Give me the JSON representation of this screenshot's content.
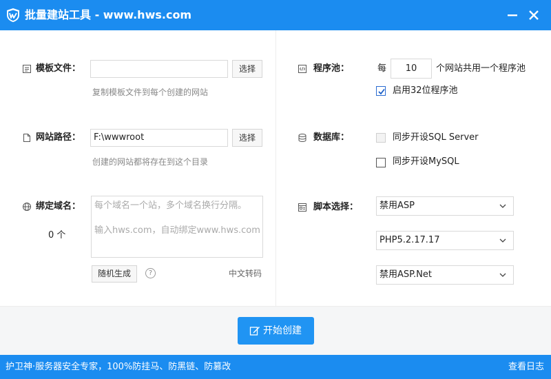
{
  "window": {
    "title": "批量建站工具 - www.hws.com"
  },
  "template": {
    "label": "模板文件：",
    "value": "",
    "button": "选择",
    "hint": "复制模板文件到每个创建的网站"
  },
  "site_path": {
    "label": "网站路径：",
    "value": "F:\\wwwroot",
    "button": "选择",
    "hint": "创建的网站都将存在到这个目录"
  },
  "domain": {
    "label": "绑定域名：",
    "count": "0 个",
    "placeholder_line1": "每个域名一个站，多个域名换行分隔。",
    "placeholder_line2": "输入hws.com，自动绑定www.hws.com",
    "random_button": "随机生成",
    "help": "?",
    "convert_link": "中文转码"
  },
  "app_pool": {
    "label": "程序池：",
    "prefix": "每",
    "value": "10",
    "suffix": "个网站共用一个程序池",
    "enable32": {
      "label": "启用32位程序池",
      "checked": true
    }
  },
  "database": {
    "label": "数据库：",
    "sqlserver": {
      "label": "同步开设SQL Server",
      "checked": false,
      "disabled": true
    },
    "mysql": {
      "label": "同步开设MySQL",
      "checked": false
    }
  },
  "script": {
    "label": "脚本选择：",
    "asp": "禁用ASP",
    "php": "PHP5.2.17.17",
    "aspnet": "禁用ASP.Net"
  },
  "actions": {
    "create": "开始创建"
  },
  "status": {
    "left": "护卫神·服务器安全专家，100%防挂马、防黑链、防篡改",
    "right": "查看日志"
  },
  "colors": {
    "accent": "#1b8cf0",
    "button_primary": "#2094f3"
  }
}
